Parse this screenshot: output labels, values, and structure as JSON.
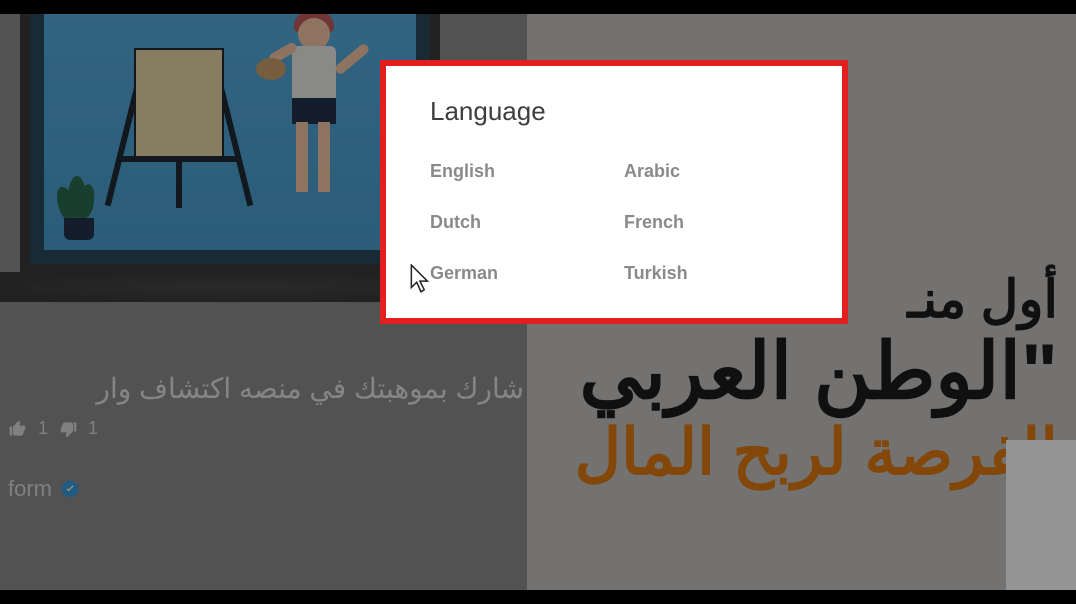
{
  "background": {
    "video_title_rtl": "شارك بموهبتك في منصه اكتشاف وار",
    "like_count": "1",
    "dislike_count": "1",
    "channel_fragment": "form",
    "headline_line1": "أول منـ",
    "headline_line2": "\"الوطن العربي",
    "headline_line3": "الفرصة لربح المال"
  },
  "modal": {
    "title": "Language",
    "options": [
      "English",
      "Arabic",
      "Dutch",
      "French",
      "German",
      "Turkish"
    ]
  }
}
